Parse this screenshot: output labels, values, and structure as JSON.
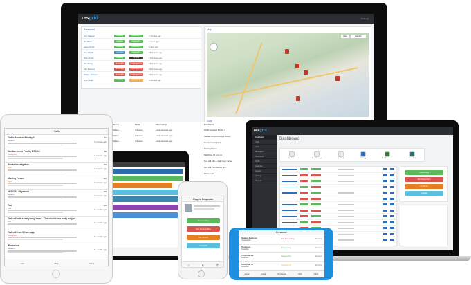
{
  "brand": {
    "prefix": "res",
    "suffix": "grid",
    "accent": "#3d8fd1"
  },
  "desktop": {
    "settings_label": "Settings",
    "personnel": {
      "title": "Personnel",
      "rows": [
        {
          "name": "Amy Wagner",
          "status": "Available",
          "state": "Responding",
          "time": "7 minutes ago"
        },
        {
          "name": "Jim Baker",
          "status": "Available",
          "state": "Responding",
          "time": "2 years ago"
        },
        {
          "name": "Jason Smith",
          "status": "Available",
          "state": "Responding",
          "time": "5 days ago"
        },
        {
          "name": "Tom Wright",
          "status": "Committed",
          "state": "Responding",
          "time": "15 minutes ago"
        },
        {
          "name": "Mike Brown",
          "status": "Available",
          "state": "On Shift",
          "time": "17 minutes ago"
        },
        {
          "name": "Jim Young",
          "status": "Unavailable",
          "state": "Not Responding",
          "time": "19 minutes ago"
        },
        {
          "name": "Karl Parsons",
          "status": "Unavailable",
          "state": "Not Responding",
          "time": "16 minutes ago"
        },
        {
          "name": "Shawn Jackson",
          "status": "Unavailable",
          "state": "Not Responding",
          "time": "16 minutes ago"
        },
        {
          "name": "Ryan Cole",
          "status": "Available",
          "state": "Standing By",
          "time": "8 minutes ago"
        }
      ]
    },
    "map": {
      "title": "Map",
      "buttons": [
        "Map",
        "Satellite"
      ]
    },
    "units_table": {
      "headers": [
        "Group",
        "State",
        "Timestamp"
      ],
      "rows": [
        {
          "group": "Station 1",
          "state": "Unknown",
          "time": "a few seconds ago"
        },
        {
          "group": "Station 1",
          "state": "Unknown",
          "time": "a few seconds ago"
        },
        {
          "group": "Station 1",
          "state": "Unknown",
          "time": "a few seconds ago"
        }
      ]
    },
    "calls": {
      "title": "Calls",
      "header": "Call Name",
      "items": [
        "Traffic Accident Priority 3",
        "Cardiac Arrest Priority 1 ECHO",
        "Smoke Investigation",
        "Missing Person",
        "MEDICAL 65 yom nb",
        "Test call with a really long 'name'",
        "Test call from iPhone app",
        "iPhone test"
      ]
    }
  },
  "ipad": {
    "title": "Calls",
    "tabs": [
      "Calls",
      "Map",
      "Status"
    ],
    "items": [
      {
        "name": "Traffic Accident Priority 3",
        "priority": "Medium",
        "id": "87",
        "time": "6 minutes ago"
      },
      {
        "name": "Cardiac Arrest Priority 1 ECHO",
        "priority": "Emergency",
        "id": "86",
        "time": "6 minutes ago"
      },
      {
        "name": "Smoke Investigation",
        "priority": "High",
        "id": "146",
        "time": "6 minutes ago"
      },
      {
        "name": "Missing Person",
        "priority": "High",
        "id": "140",
        "time": "6 minutes ago"
      },
      {
        "name": "MEDICAL 65 yom nb",
        "priority": "Medium",
        "id": "139",
        "time": "6 minutes ago"
      },
      {
        "name": "Test",
        "priority": "Low",
        "id": "102",
        "time": "11 months ago"
      },
      {
        "name": "Test call with a really long 'name'. This should be a really long na",
        "priority": "Low",
        "id": "",
        "time": "11 months ago"
      },
      {
        "name": "Test call from iPhone app",
        "priority": "Emergency",
        "id": "",
        "time": "11 months ago"
      },
      {
        "name": "iPhone test",
        "priority": "Medium",
        "id": "",
        "time": "11 months ago"
      }
    ]
  },
  "iphone_white": {
    "title": "Resgrid Responder",
    "buttons": [
      "Responding",
      "Not Responding",
      "On Scene",
      "Available"
    ]
  },
  "laptop": {
    "title": "Dashboard",
    "actions": [
      "Set Status",
      "Send Message",
      "Add Call",
      "Call Log",
      "Add Personnel",
      "Send Alert"
    ],
    "sidebar": [
      "Dashboard",
      "Calls",
      "Units",
      "Messages",
      "Personnel",
      "Shifts",
      "Calendar",
      "Groups",
      "Settings",
      "Reports"
    ],
    "buttons": [
      "Responding",
      "Not Responding",
      "On Scene",
      "Available"
    ]
  },
  "iphone_blue": {
    "title": "Personnel",
    "rows": [
      {
        "name": "Shawn Jackson",
        "status": "Unavailable",
        "state": "Not Responding",
        "time": "10 mins"
      },
      {
        "name": "Test user",
        "status": "Available",
        "state": "Responding",
        "time": "10 mins"
      },
      {
        "name": "Test UserXX",
        "status": "Available",
        "state": "Responding",
        "time": "10 mins"
      },
      {
        "name": "Test UserYY",
        "status": "Available",
        "state": "Standing By",
        "time": "10 mins"
      }
    ],
    "tabs": [
      "Home",
      "Calls",
      "Personnel",
      "Units",
      "More"
    ]
  }
}
